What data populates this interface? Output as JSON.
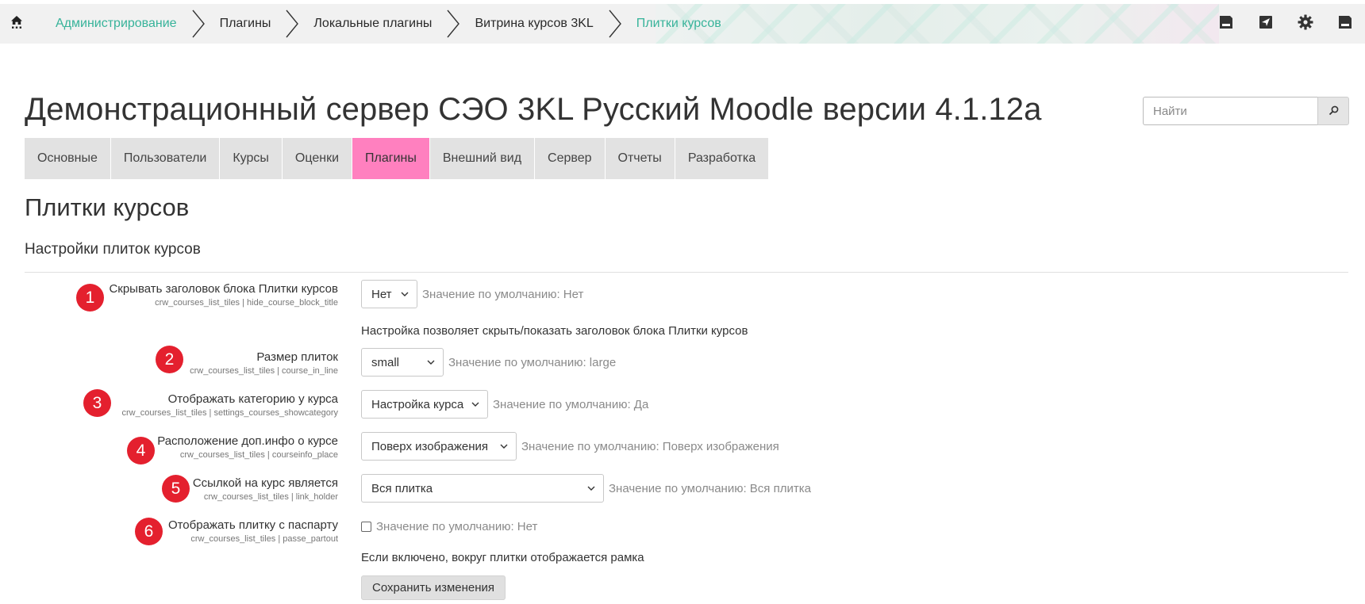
{
  "navbar": {
    "home_icon": "home-icon",
    "breadcrumbs": [
      {
        "label": "Администрирование",
        "accent": true
      },
      {
        "label": "Плагины",
        "accent": false
      },
      {
        "label": "Локальные плагины",
        "accent": false
      },
      {
        "label": "Витрина курсов 3KL",
        "accent": false
      },
      {
        "label": "Плитки курсов",
        "accent": true
      }
    ],
    "right_icons": [
      "save-icon",
      "send-icon",
      "gear-icon",
      "save-icon"
    ],
    "accent_color": "#37b39a"
  },
  "header": {
    "title": "Демонстрационный сервер СЭО 3KL Русский Moodle версии 4.1.12a",
    "search_placeholder": "Найти",
    "search_icon": "search-icon"
  },
  "tabs": {
    "items": [
      {
        "label": "Основные"
      },
      {
        "label": "Пользователи"
      },
      {
        "label": "Курсы"
      },
      {
        "label": "Оценки"
      },
      {
        "label": "Плагины"
      },
      {
        "label": "Внешний вид"
      },
      {
        "label": "Сервер"
      },
      {
        "label": "Отчеты"
      },
      {
        "label": "Разработка"
      }
    ],
    "active_index": 4,
    "active_color": "#ff80bf"
  },
  "main": {
    "page_heading": "Плитки курсов",
    "section_heading": "Настройки плиток курсов",
    "badge_color": "#e4202e",
    "settings": [
      {
        "number": "1",
        "name": "Скрывать заголовок блока Плитки курсов",
        "key": "crw_courses_list_tiles | hide_course_block_title",
        "control": "select",
        "value": "Нет",
        "default": "Значение по умолчанию: Нет",
        "description": "Настройка позволяет скрыть/показать заголовок блока Плитки курсов"
      },
      {
        "number": "2",
        "name": "Размер плиток",
        "key": "crw_courses_list_tiles | course_in_line",
        "control": "select",
        "value": "small",
        "default": "Значение по умолчанию: large"
      },
      {
        "number": "3",
        "name": "Отображать категорию у курса",
        "key": "crw_courses_list_tiles | settings_courses_showcategory",
        "control": "select",
        "value": "Настройка курса",
        "default": "Значение по умолчанию: Да"
      },
      {
        "number": "4",
        "name": "Расположение доп.инфо о курсе",
        "key": "crw_courses_list_tiles | courseinfo_place",
        "control": "select",
        "value": "Поверх изображения",
        "default": "Значение по умолчанию: Поверх изображения"
      },
      {
        "number": "5",
        "name": "Ссылкой на курс является",
        "key": "crw_courses_list_tiles | link_holder",
        "control": "select",
        "value": "Вся плитка",
        "default": "Значение по умолчанию: Вся плитка"
      },
      {
        "number": "6",
        "name": "Отображать плитку с паспарту",
        "key": "crw_courses_list_tiles | passe_partout",
        "control": "checkbox",
        "checked": false,
        "default": "Значение по умолчанию: Нет",
        "description": "Если включено, вокруг плитки отображается рамка"
      }
    ],
    "save_label": "Сохранить изменения"
  }
}
